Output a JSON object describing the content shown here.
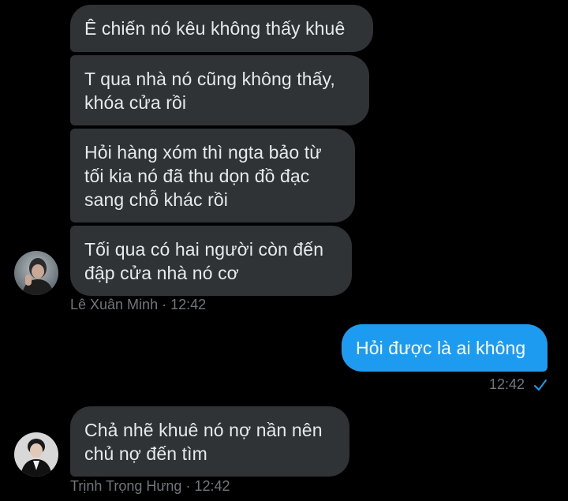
{
  "conversation": {
    "group1": {
      "messages": [
        "Ê chiến nó kêu không thấy khuê",
        "T qua nhà nó cũng không thấy,\nkhóa cửa rồi",
        "Hỏi hàng xóm thì ngta bảo từ\ntối kia nó đã thu dọn đồ đạc\nsang chỗ khác rồi",
        "Tối qua có hai người còn đến\nđập cửa nhà nó cơ"
      ],
      "sender": "Lê Xuân Minh",
      "separator": "·",
      "time": "12:42"
    },
    "outgoing": {
      "message": "Hỏi được là ai không",
      "time": "12:42",
      "status_icon": "check-icon"
    },
    "group2": {
      "messages": [
        "Chả nhẽ khuê nó nợ nần nên\nchủ nợ đến tìm"
      ],
      "sender": "Trịnh Trọng Hưng",
      "separator": "·",
      "time": "12:42"
    }
  },
  "colors": {
    "background": "#000000",
    "incoming_bubble": "#2f3336",
    "outgoing_bubble": "#1d9bf0",
    "meta_text": "#71767b",
    "check": "#1d9bf0"
  }
}
